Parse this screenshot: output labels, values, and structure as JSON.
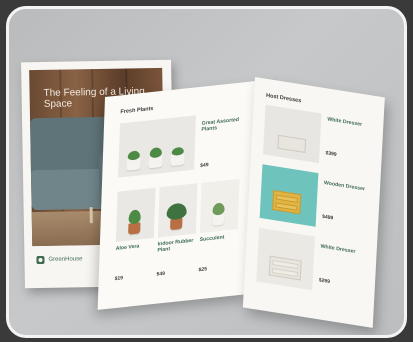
{
  "cover": {
    "title": "The Feeling of a Living Space",
    "brand": "GreenHouse"
  },
  "left_page": {
    "section": "Fresh Plants",
    "feature_title": "Great Assorted Plants",
    "feature_price": "$49",
    "items": [
      {
        "name": "Aloe Vera",
        "price": "$19"
      },
      {
        "name": "Indoor Rubber Plant",
        "price": "$49"
      },
      {
        "name": "Succulent",
        "price": "$25"
      }
    ]
  },
  "right_page": {
    "section": "Host Dresses",
    "items": [
      {
        "name": "White Dresser",
        "price": "$399"
      },
      {
        "name": "Wooden Dresser",
        "price": "$499"
      },
      {
        "name": "White Dresser",
        "price": "$299"
      }
    ]
  },
  "colors": {
    "accent": "#3f6b53",
    "background": "#c0c2c4",
    "frame": "#f4f4f4"
  }
}
